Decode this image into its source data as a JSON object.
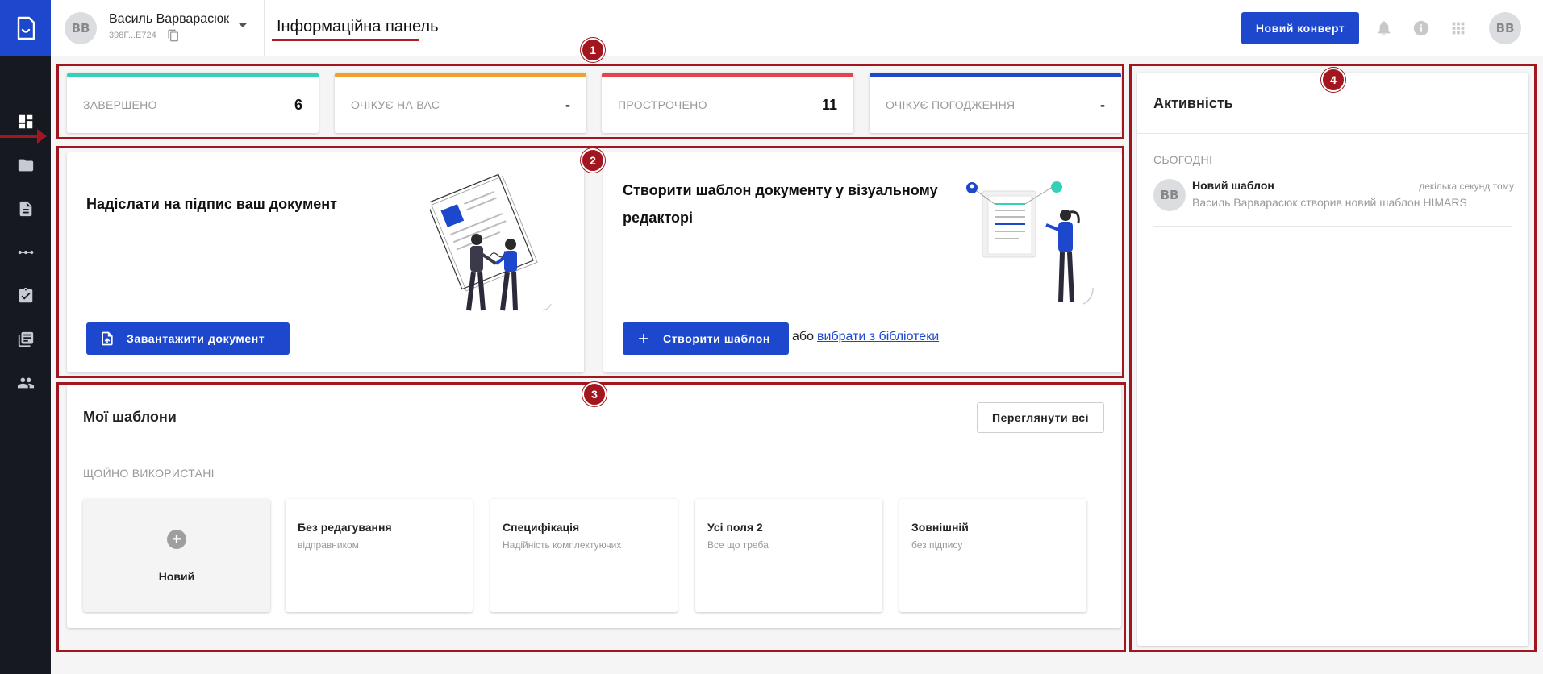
{
  "header": {
    "avatar_initials": "ВВ",
    "user_name": "Василь Варварасюк",
    "user_id": "398F...E724",
    "page_title": "Інформаційна панель",
    "new_envelope_label": "Новий конверт"
  },
  "sidebar": {
    "items": [
      {
        "icon": "dashboard-icon",
        "active": true
      },
      {
        "icon": "folder-icon"
      },
      {
        "icon": "document-icon"
      },
      {
        "icon": "workflow-icon"
      },
      {
        "icon": "clipboard-check-icon"
      },
      {
        "icon": "library-icon"
      },
      {
        "icon": "people-icon"
      }
    ]
  },
  "stats": [
    {
      "label": "ЗАВЕРШЕНО",
      "value": "6",
      "color": "#35d0ba"
    },
    {
      "label": "ОЧІКУЄ НА ВАС",
      "value": "-",
      "color": "#f0a02c"
    },
    {
      "label": "ПРОСТРОЧЕНО",
      "value": "11",
      "color": "#e2454f"
    },
    {
      "label": "ОЧІКУЄ ПОГОДЖЕННЯ",
      "value": "-",
      "color": "#1d47cc"
    }
  ],
  "actions": {
    "upload": {
      "text": "Надіслати на підпис ваш документ",
      "button": "Завантажити документ"
    },
    "create": {
      "text_line1": "Створити шаблон документу у візуальному",
      "text_line2": "редакторі",
      "button": "Створити шаблон",
      "or": "або",
      "link": "вибрати з бібліотеки"
    }
  },
  "templates": {
    "title": "Мої шаблони",
    "view_all": "Переглянути всі",
    "recent_label": "ЩОЙНО ВИКОРИСТАНІ",
    "new_label": "Новий",
    "items": [
      {
        "name": "Без редагування",
        "desc": "відправником"
      },
      {
        "name": "Специфікація",
        "desc": "Надійність комплектуючих"
      },
      {
        "name": "Усі поля 2",
        "desc": "Все що треба"
      },
      {
        "name": "Зовнішній",
        "desc": "без підпису"
      }
    ]
  },
  "activity": {
    "title": "Активність",
    "today_label": "СЬОГОДНІ",
    "items": [
      {
        "avatar": "ВВ",
        "title": "Новий шаблон",
        "time": "декілька секунд тому",
        "desc": "Василь Варварасюк створив новий шаблон HIMARS"
      }
    ]
  },
  "annotations": [
    "1",
    "2",
    "3",
    "4"
  ],
  "colors": {
    "brand": "#1d47cc",
    "annotation": "#a2161f",
    "sidebar": "#161a20"
  }
}
